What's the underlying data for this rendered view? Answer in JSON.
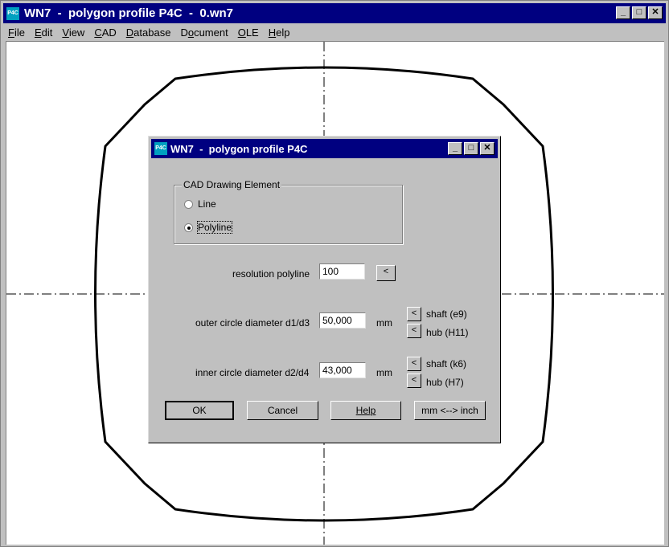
{
  "main_window": {
    "title": "WN7  -  polygon profile P4C  -  0.wn7",
    "icon_label": "P4C",
    "controls": {
      "minimize": "_",
      "maximize": "□",
      "close": "✕"
    }
  },
  "menu": [
    {
      "label": "File",
      "u": "F"
    },
    {
      "label": "Edit",
      "u": "E"
    },
    {
      "label": "View",
      "u": "V"
    },
    {
      "label": "CAD",
      "u": "C"
    },
    {
      "label": "Database",
      "u": "D"
    },
    {
      "label": "Document",
      "u": "o"
    },
    {
      "label": "OLE",
      "u": "O"
    },
    {
      "label": "Help",
      "u": "H"
    }
  ],
  "dialog": {
    "title": "WN7  -  polygon profile P4C",
    "icon_label": "P4C",
    "group_title": "CAD Drawing Element",
    "radio_line": "Line",
    "radio_polyline": "Polyline",
    "selected": "Polyline",
    "resolution_label": "resolution polyline",
    "resolution_value": "100",
    "outer_label": "outer circle diameter d1/d3",
    "outer_value": "50,000",
    "outer_unit": "mm",
    "inner_label": "inner circle diameter d2/d4",
    "inner_value": "43,000",
    "inner_unit": "mm",
    "arrow": "<",
    "outer_shaft": "shaft (e9)",
    "outer_hub": "hub (H11)",
    "inner_shaft": "shaft (k6)",
    "inner_hub": "hub (H7)",
    "ok": "OK",
    "cancel": "Cancel",
    "help": "Help",
    "unit_toggle": "mm <--> inch"
  }
}
